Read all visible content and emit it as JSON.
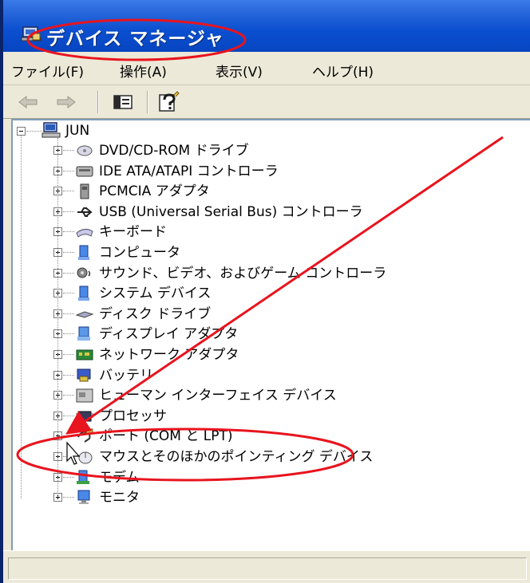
{
  "window": {
    "title": "デバイス マネージャ"
  },
  "menu": [
    {
      "label": "ファイル(F)"
    },
    {
      "label": "操作(A)"
    },
    {
      "label": "表示(V)"
    },
    {
      "label": "ヘルプ(H)"
    }
  ],
  "toolbar": {
    "buttons": [
      {
        "icon": "back-arrow-icon"
      },
      {
        "icon": "forward-arrow-icon"
      },
      {
        "icon": "properties-icon"
      },
      {
        "icon": "help-icon"
      }
    ]
  },
  "tree": {
    "root": {
      "label": "JUN",
      "icon": "computer-icon",
      "expanded": true
    },
    "children": [
      {
        "label": "DVD/CD-ROM ドライブ",
        "icon": "cdrom-icon"
      },
      {
        "label": "IDE ATA/ATAPI コントローラ",
        "icon": "ide-controller-icon"
      },
      {
        "label": "PCMCIA アダプタ",
        "icon": "pcmcia-icon"
      },
      {
        "label": "USB (Universal Serial Bus) コントローラ",
        "icon": "usb-icon"
      },
      {
        "label": "キーボード",
        "icon": "keyboard-icon"
      },
      {
        "label": "コンピュータ",
        "icon": "computer-small-icon"
      },
      {
        "label": "サウンド、ビデオ、およびゲーム コントローラ",
        "icon": "sound-icon"
      },
      {
        "label": "システム デバイス",
        "icon": "system-device-icon"
      },
      {
        "label": "ディスク ドライブ",
        "icon": "disk-drive-icon"
      },
      {
        "label": "ディスプレイ アダプタ",
        "icon": "display-adapter-icon"
      },
      {
        "label": "ネットワーク アダプタ",
        "icon": "network-adapter-icon"
      },
      {
        "label": "バッテリ",
        "icon": "battery-icon"
      },
      {
        "label": "ヒューマン インターフェイス デバイス",
        "icon": "hid-icon"
      },
      {
        "label": "プロセッサ",
        "icon": "processor-icon"
      },
      {
        "label": "ポート (COM と LPT)",
        "icon": "port-icon"
      },
      {
        "label": "マウスとそのほかのポインティング デバイス",
        "icon": "mouse-icon"
      },
      {
        "label": "モデム",
        "icon": "modem-icon"
      },
      {
        "label": "モニタ",
        "icon": "monitor-icon"
      }
    ]
  },
  "colors": {
    "titlebar": "#0a4fd0",
    "annotation_red": "#e8141e",
    "chrome": "#ece9d8"
  }
}
